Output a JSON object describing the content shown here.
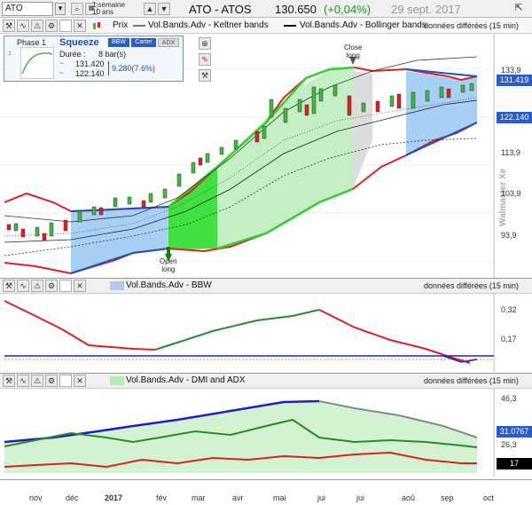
{
  "toolbar": {
    "symbol": "ATO",
    "period_lines": [
      "1 semaine",
      "10 ans"
    ],
    "price_label": "Prix",
    "indicator_1": "Vol.Bands.Adv - Keltner bands",
    "indicator_2": "Vol.Bands.Adv - Bollinger bands"
  },
  "header": {
    "instrument": "ATO - ATOS",
    "price": "130.650",
    "change": "(+0,04%)",
    "date": "29 sept. 2017",
    "delay": "données différées (15 min)"
  },
  "info_box": {
    "phase": "Phase 1",
    "squeeze": "Squeeze",
    "buttons": [
      "BBW",
      "Carter",
      "ADX"
    ],
    "duration_label": "Durée :",
    "duration_value": "8 bar(s)",
    "upper": "131.420",
    "lower": "122.140",
    "range": "9.280(7.6%)"
  },
  "annotations": {
    "close": [
      "Close",
      "long"
    ],
    "open": [
      "Open",
      "long"
    ],
    "watermark": "Walmaster Xe"
  },
  "price_panel": {
    "y_ticks": [
      "133,9",
      "123,9",
      "113,9",
      "103,9",
      "93,9"
    ],
    "upper_tag": "131.419",
    "lower_tag": "122.140"
  },
  "bbw_panel": {
    "title": "Vol.Bands.Adv - BBW",
    "delay": "données différées (15 min)",
    "y_ticks": [
      "0,32",
      "0,17"
    ]
  },
  "dmi_panel": {
    "title": "Vol.Bands.Adv - DMI and ADX",
    "delay": "données différées (15 min)",
    "y_ticks": [
      "46,3",
      "26,3"
    ],
    "tag_adx": "31.0767",
    "tag_low": "17"
  },
  "x_axis": [
    "nov",
    "déc",
    "2017",
    "fév",
    "mar",
    "avr",
    "mai",
    "jui",
    "jui",
    "aoû",
    "sep",
    "oct"
  ],
  "colors": {
    "up": "#3dbb3d",
    "down": "#e02020",
    "band_green": "#7de07d",
    "band_blue": "#9fc8f0",
    "adx": "#2020c0"
  }
}
